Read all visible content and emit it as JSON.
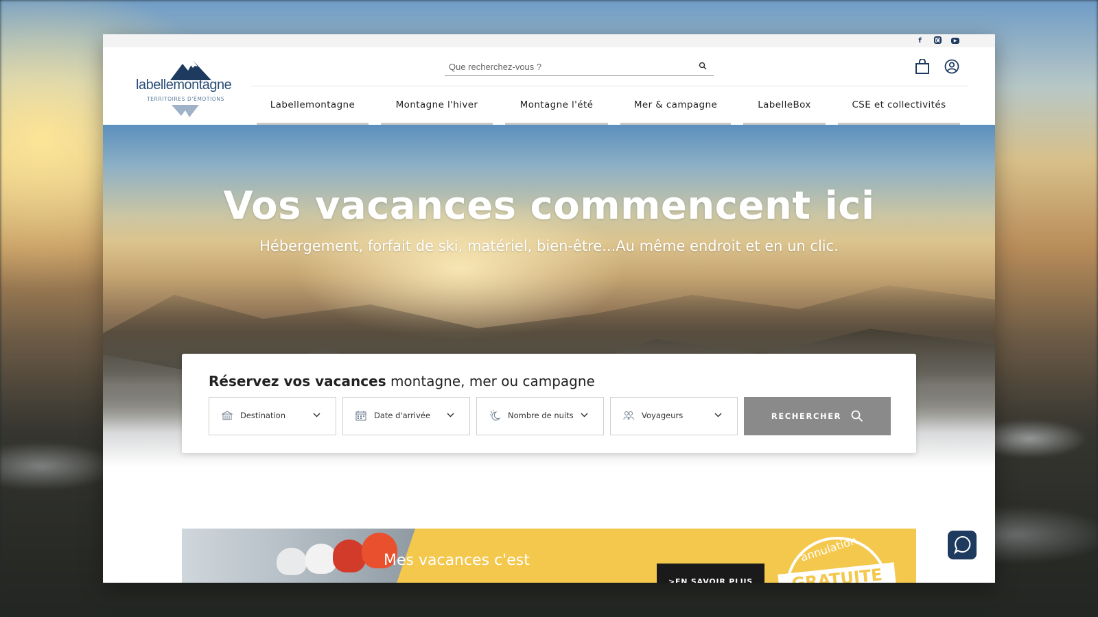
{
  "brand": {
    "name": "labellemontagne",
    "tagline": "TERRITOIRES D'ÉMOTIONS"
  },
  "social": [
    {
      "icon": "facebook-icon",
      "glyph": "f"
    },
    {
      "icon": "instagram-icon",
      "glyph": ""
    },
    {
      "icon": "youtube-icon",
      "glyph": "▶"
    }
  ],
  "search": {
    "placeholder": "Que recherchez-vous ?"
  },
  "nav": {
    "items": [
      {
        "label": "Labellemontagne"
      },
      {
        "label": "Montagne l'hiver"
      },
      {
        "label": "Montagne l'été"
      },
      {
        "label": "Mer & campagne"
      },
      {
        "label": "LabelleBox"
      },
      {
        "label": "CSE et collectivités"
      }
    ]
  },
  "hero": {
    "title": "Vos vacances commencent ici",
    "subtitle": "Hébergement, forfait de ski, matériel, bien-être...Au même endroit et en un clic."
  },
  "booking": {
    "title_bold": "Réservez vos vacances",
    "title_rest": " montagne, mer ou campagne",
    "fields": [
      {
        "label": "Destination",
        "icon": "building-icon"
      },
      {
        "label": "Date d'arrivée",
        "icon": "calendar-icon"
      },
      {
        "label": "Nombre de nuits",
        "icon": "moon-icon"
      },
      {
        "label": "Voyageurs",
        "icon": "travelers-icon"
      }
    ],
    "search_button": "RECHERCHER"
  },
  "promo": {
    "text": "Mes vacances c'est",
    "button": ">EN SAVOIR PLUS",
    "stamp_top": "annulation",
    "stamp_main": "GRATUITE"
  },
  "colors": {
    "brand_navy": "#1e3a5f",
    "button_gray": "#8a8a8a",
    "promo_yellow": "#f4c84d"
  }
}
